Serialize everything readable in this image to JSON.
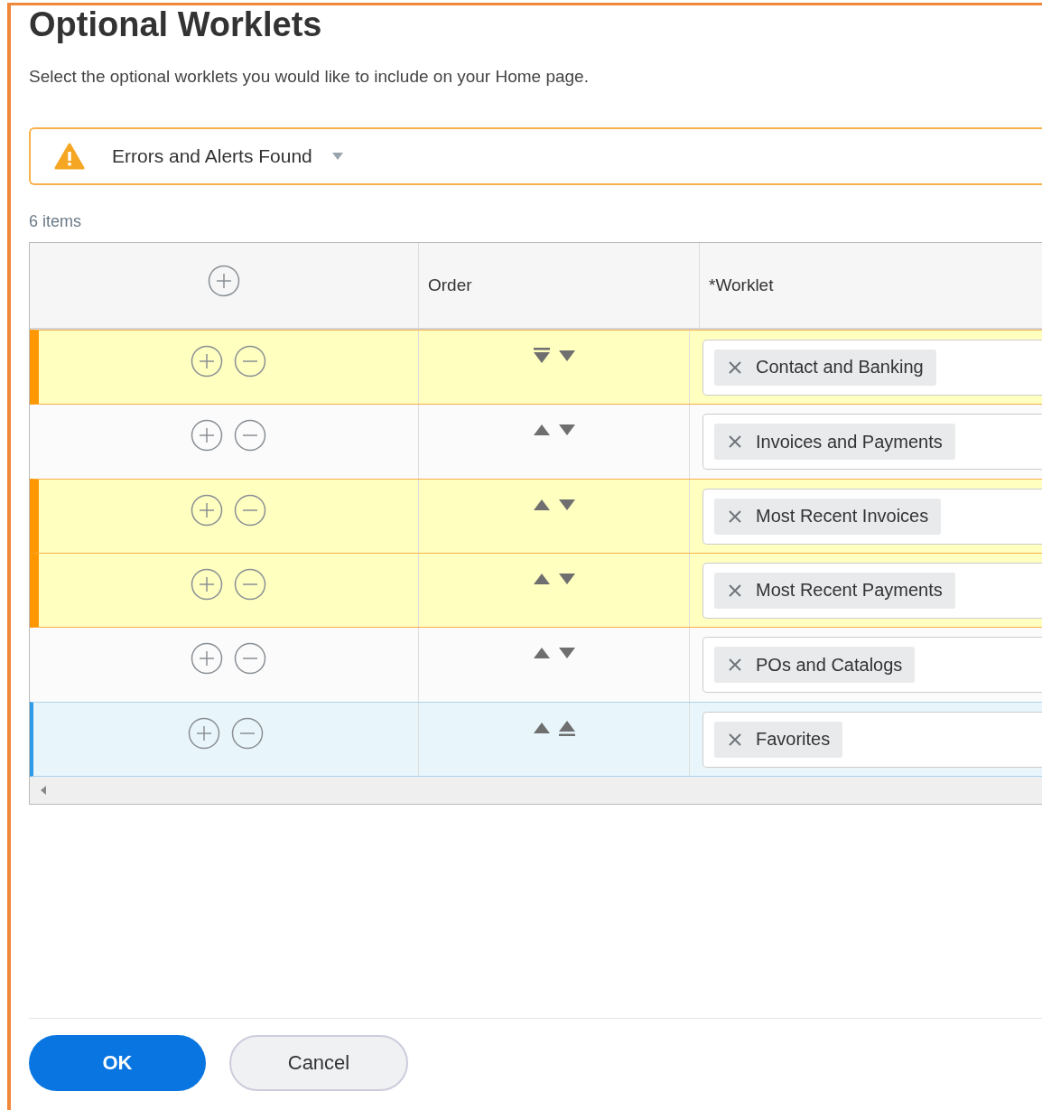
{
  "title": "Optional Worklets",
  "subtitle": "Select the optional worklets you would like to include on your Home page.",
  "alert": {
    "label": "Errors and Alerts Found"
  },
  "item_count": "6 items",
  "table": {
    "columns": [
      "Order",
      "*Worklet"
    ],
    "rows": [
      {
        "has_alert": true,
        "selected": false,
        "worklet": "Contact and Banking"
      },
      {
        "has_alert": false,
        "selected": false,
        "worklet": "Invoices and Payments"
      },
      {
        "has_alert": true,
        "selected": false,
        "worklet": "Most Recent Invoices"
      },
      {
        "has_alert": true,
        "selected": false,
        "worklet": "Most Recent Payments"
      },
      {
        "has_alert": false,
        "selected": false,
        "worklet": "POs and Catalogs"
      },
      {
        "has_alert": false,
        "selected": true,
        "worklet": "Favorites"
      }
    ]
  },
  "buttons": [
    {
      "label": "OK",
      "kind": "primary"
    },
    {
      "label": "Cancel",
      "kind": "secondary"
    }
  ]
}
